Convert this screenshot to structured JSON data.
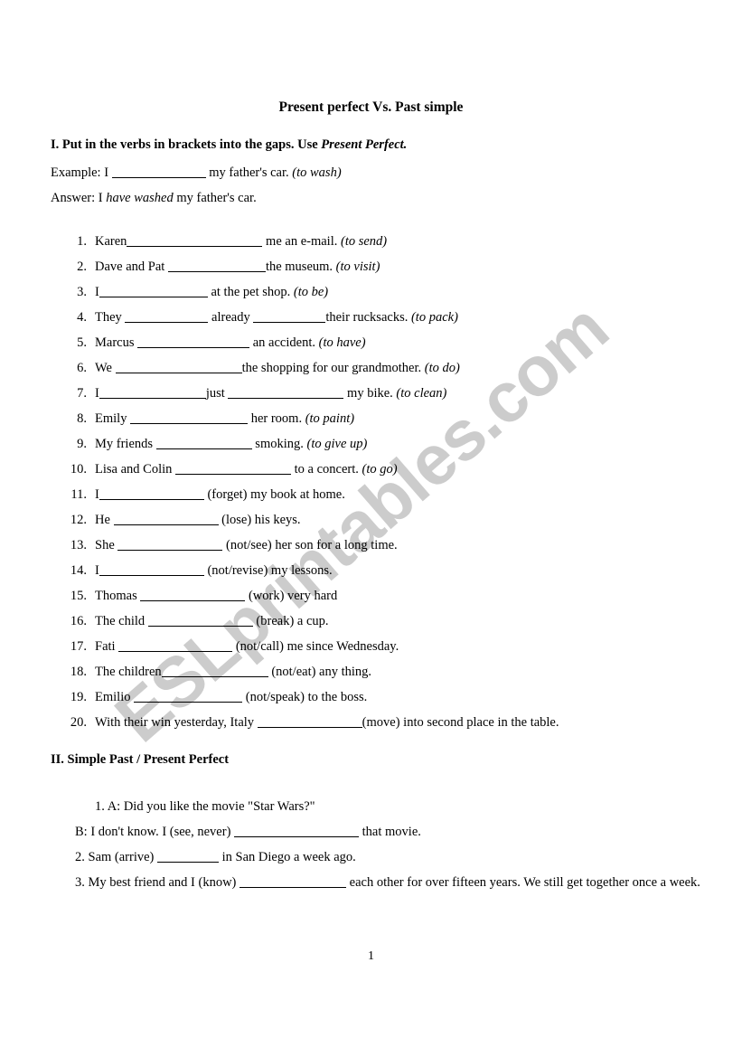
{
  "document": {
    "title": "Present perfect Vs. Past simple",
    "page_number": "1",
    "watermark": "ESLprintables.com",
    "watermark_color": "#cccccc"
  },
  "section_one": {
    "heading_prefix": "I. Put in the verbs in brackets into the gaps. Use ",
    "heading_italic": "Present Perfect.",
    "example_prefix": "Example: I ",
    "example_suffix": " my father's car. ",
    "example_verb": "(to wash)",
    "answer_prefix": "Answer: I ",
    "answer_italic": "have washed",
    "answer_suffix": " my father's car.",
    "items": [
      {
        "n": "1.",
        "before": "Karen",
        "blank_w": 150,
        "after": " me an e-mail. ",
        "verb": "(to send)"
      },
      {
        "n": "2.",
        "before": "Dave and Pat ",
        "blank_w": 108,
        "after": "the museum. ",
        "verb": "(to visit)"
      },
      {
        "n": "3.",
        "before": "I",
        "blank_w": 120,
        "after": " at the pet shop. ",
        "verb": "(to be)"
      },
      {
        "n": "4.",
        "before": "They ",
        "blank_w": 92,
        "mid": " already ",
        "blank2_w": 80,
        "after": "their rucksacks. ",
        "verb": "(to pack)"
      },
      {
        "n": "5.",
        "before": "Marcus ",
        "blank_w": 124,
        "after": " an accident. ",
        "verb": "(to have)"
      },
      {
        "n": "6.",
        "before": "We ",
        "blank_w": 140,
        "after": "the shopping for our grandmother. ",
        "verb": "(to do)"
      },
      {
        "n": "7.",
        "before": "I",
        "blank_w": 118,
        "mid": "just ",
        "blank2_w": 128,
        "after": " my bike. ",
        "verb": "(to clean)"
      },
      {
        "n": "8.",
        "before": "Emily ",
        "blank_w": 130,
        "after": " her room. ",
        "verb": "(to paint)"
      },
      {
        "n": "9.",
        "before": "My friends ",
        "blank_w": 106,
        "after": " smoking. ",
        "verb": "(to give up)"
      },
      {
        "n": "10.",
        "before": "Lisa and Colin ",
        "blank_w": 128,
        "after": " to a concert. ",
        "verb": "(to go)"
      },
      {
        "n": "11.",
        "before": "I",
        "blank_w": 116,
        "after": " (forget) my book at home.",
        "verb": ""
      },
      {
        "n": "12.",
        "before": "He ",
        "blank_w": 116,
        "after": " (lose) his keys.",
        "verb": ""
      },
      {
        "n": "13.",
        "before": "She ",
        "blank_w": 116,
        "after": " (not/see) her son for a long time.",
        "verb": ""
      },
      {
        "n": "14.",
        "before": "I",
        "blank_w": 116,
        "after": " (not/revise) my lessons.",
        "verb": ""
      },
      {
        "n": "15.",
        "before": "Thomas ",
        "blank_w": 116,
        "after": " (work) very hard",
        "verb": ""
      },
      {
        "n": "16.",
        "before": "The child ",
        "blank_w": 116,
        "after": " (break) a cup.",
        "verb": ""
      },
      {
        "n": "17.",
        "before": "Fati ",
        "blank_w": 126,
        "after": " (not/call) me since Wednesday.",
        "verb": ""
      },
      {
        "n": "18.",
        "before": "The children",
        "blank_w": 118,
        "after": " (not/eat) any thing.",
        "verb": ""
      },
      {
        "n": "19.",
        "before": "Emilio ",
        "blank_w": 120,
        "after": " (not/speak) to the boss.",
        "verb": ""
      },
      {
        "n": "20.",
        "before": "With their win yesterday, Italy ",
        "blank_w": 116,
        "after": "(move) into second place in the table.",
        "verb": ""
      }
    ]
  },
  "section_two": {
    "heading": "II. Simple Past / Present Perfect",
    "item1": "1.   A: Did you like the movie \"Star Wars?\"",
    "item1b_before": "B: I don't know. I (see, never) ",
    "item1b_blank_w": 138,
    "item1b_after": " that movie.",
    "item2_before": "2. Sam (arrive) ",
    "item2_blank_w": 68,
    "item2_after": " in San Diego a week ago.",
    "item3_before": "3. My best friend and I (know) ",
    "item3_blank_w": 118,
    "item3_after": " each other for over fifteen years. We still get together once a week."
  }
}
